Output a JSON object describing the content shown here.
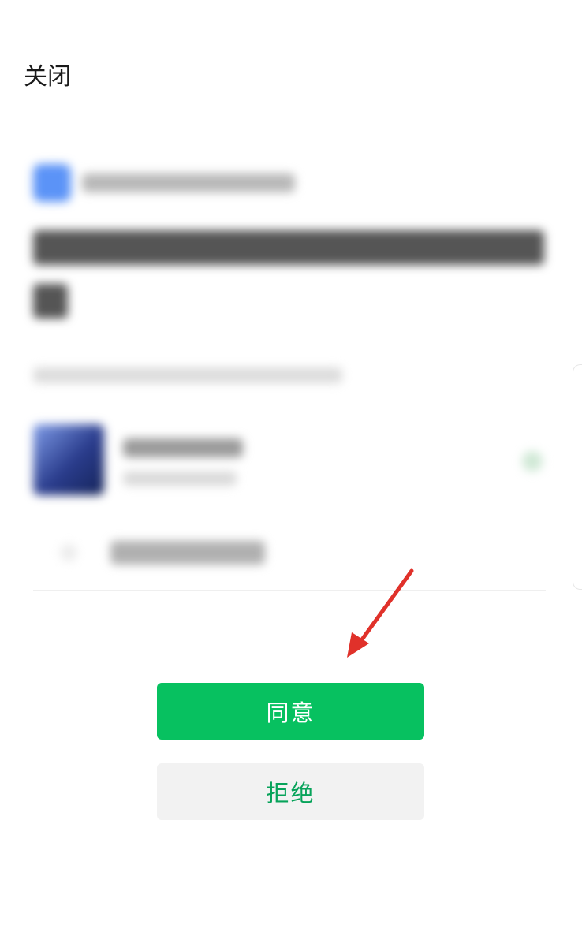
{
  "header": {
    "close_label": "关闭"
  },
  "actions": {
    "agree_label": "同意",
    "reject_label": "拒绝"
  },
  "colors": {
    "primary": "#07c160",
    "reject_text": "#07a35a",
    "reject_bg": "#f2f2f2",
    "annotation_arrow": "#e0312a"
  }
}
